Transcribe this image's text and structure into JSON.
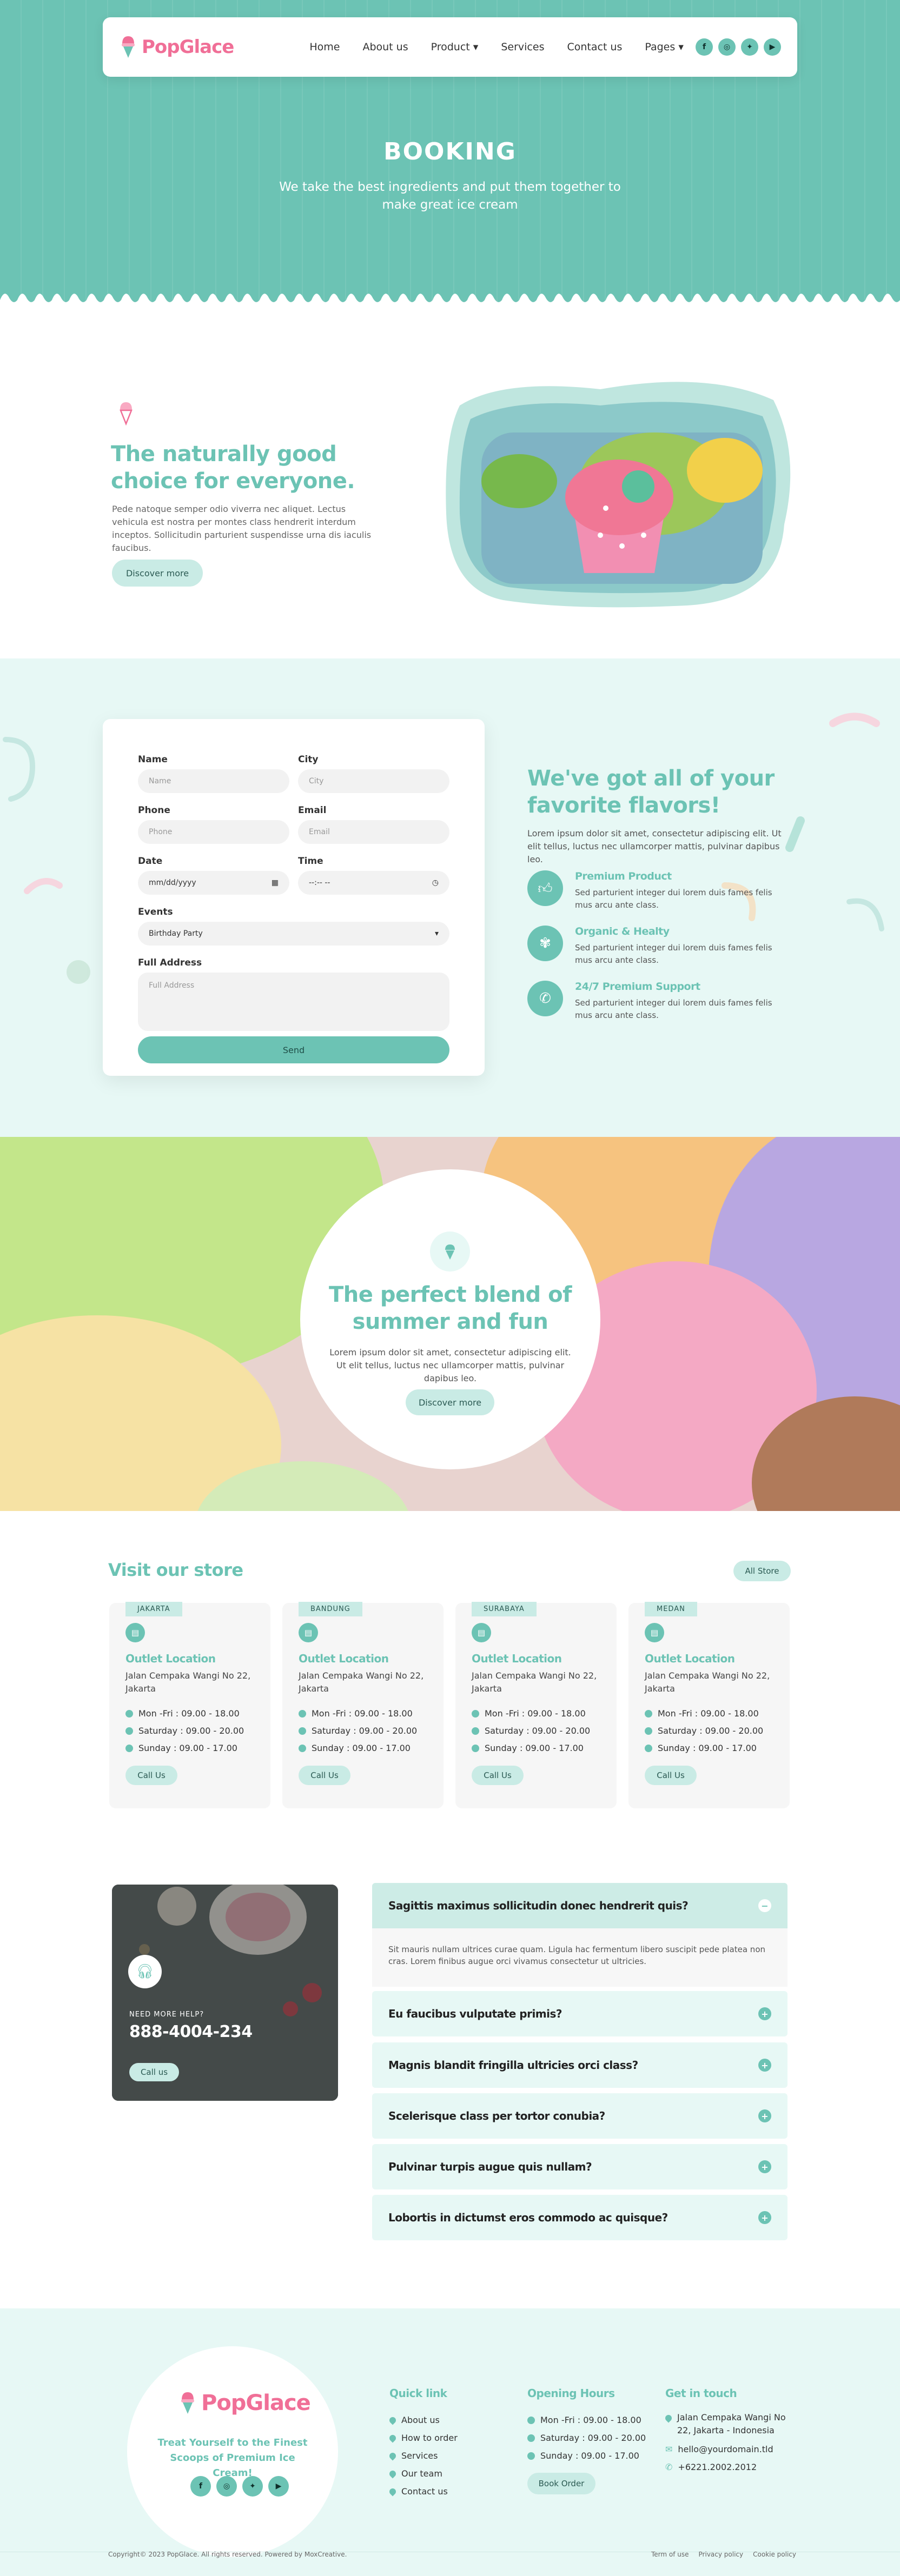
{
  "brand": {
    "name": "PopGlace",
    "accent": "#6cc3b4",
    "logo_color": "#f06f97"
  },
  "nav": {
    "items": [
      "Home",
      "About us",
      "Product",
      "Services",
      "Contact us",
      "Pages"
    ],
    "dropdown_items": [
      "Product",
      "Pages"
    ],
    "socials": [
      "facebook-icon",
      "instagram-icon",
      "twitter-icon",
      "youtube-icon"
    ]
  },
  "hero": {
    "title": "BOOKING",
    "subtitle": "We take the best ingredients and put them together to make great ice cream"
  },
  "intro": {
    "title": "The naturally good choice for everyone.",
    "text": "Pede natoque semper odio viverra nec aliquet. Lectus vehicula est nostra per montes class hendrerit interdum inceptos. Sollicitudin parturient suspendisse urna dis iaculis faucibus.",
    "button": "Discover more"
  },
  "form": {
    "name_label": "Name",
    "name_placeholder": "Name",
    "city_label": "City",
    "city_placeholder": "City",
    "phone_label": "Phone",
    "phone_placeholder": "Phone",
    "email_label": "Email",
    "email_placeholder": "Email",
    "date_label": "Date",
    "date_placeholder": "mm/dd/yyyy",
    "time_label": "Time",
    "time_placeholder": "--:-- --",
    "events_label": "Events",
    "events_value": "Birthday Party",
    "address_label": "Full Address",
    "address_placeholder": "Full Address",
    "send": "Send"
  },
  "flavors": {
    "title": "We've got all of your favorite flavors!",
    "text": "Lorem ipsum dolor sit amet, consectetur adipiscing elit. Ut elit tellus, luctus nec ullamcorper mattis, pulvinar dapibus leo.",
    "features": [
      {
        "title": "Premium Product",
        "text": "Sed parturient integer dui lorem duis fames felis mus arcu ante class.",
        "icon": "thumbs-up-icon"
      },
      {
        "title": "Organic & Healty",
        "text": "Sed parturient integer dui lorem duis fames felis mus arcu ante class.",
        "icon": "wheat-icon"
      },
      {
        "title": "24/7 Premium Support",
        "text": "Sed parturient integer dui lorem duis fames felis mus arcu ante class.",
        "icon": "phone-icon"
      }
    ]
  },
  "blend": {
    "title": "The perfect blend of summer and fun",
    "text": "Lorem ipsum dolor sit amet, consectetur adipiscing elit. Ut elit tellus, luctus nec ullamcorper mattis, pulvinar dapibus leo.",
    "button": "Discover more"
  },
  "stores": {
    "title": "Visit our store",
    "all_button": "All Store",
    "items": [
      {
        "tag": "JAKARTA",
        "name": "Outlet Location",
        "address": "Jalan Cempaka Wangi No 22, Jakarta",
        "hours": [
          "Mon -Fri : 09.00 - 18.00",
          "Saturday : 09.00 - 20.00",
          "Sunday : 09.00 - 17.00"
        ],
        "button": "Call Us"
      },
      {
        "tag": "BANDUNG",
        "name": "Outlet Location",
        "address": "Jalan Cempaka Wangi No 22, Jakarta",
        "hours": [
          "Mon -Fri : 09.00 - 18.00",
          "Saturday : 09.00 - 20.00",
          "Sunday : 09.00 - 17.00"
        ],
        "button": "Call Us"
      },
      {
        "tag": "SURABAYA",
        "name": "Outlet Location",
        "address": "Jalan Cempaka Wangi No 22, Jakarta",
        "hours": [
          "Mon -Fri : 09.00 - 18.00",
          "Saturday : 09.00 - 20.00",
          "Sunday : 09.00 - 17.00"
        ],
        "button": "Call Us"
      },
      {
        "tag": "MEDAN",
        "name": "Outlet Location",
        "address": "Jalan Cempaka Wangi No 22, Jakarta",
        "hours": [
          "Mon -Fri : 09.00 - 18.00",
          "Saturday : 09.00 - 20.00",
          "Sunday : 09.00 - 17.00"
        ],
        "button": "Call Us"
      }
    ]
  },
  "help": {
    "label": "NEED MORE HELP?",
    "phone": "888-4004-234",
    "button": "Call us"
  },
  "faq": {
    "items": [
      {
        "q": "Sagittis maximus sollicitudin donec hendrerit quis?",
        "a": "Sit mauris nullam ultrices curae quam. Ligula hac fermentum libero suscipit pede platea non cras. Lorem finibus augue orci vivamus consectetur ut ultricies.",
        "open": true
      },
      {
        "q": "Eu faucibus vulputate primis?",
        "open": false
      },
      {
        "q": "Magnis blandit fringilla ultricies orci class?",
        "open": false
      },
      {
        "q": "Scelerisque class per tortor conubia?",
        "open": false
      },
      {
        "q": "Pulvinar turpis augue quis nullam?",
        "open": false
      },
      {
        "q": "Lobortis in dictumst eros commodo ac quisque?",
        "open": false
      }
    ]
  },
  "footer": {
    "tagline": "Treat Yourself to the Finest Scoops of Premium Ice Cream!",
    "quick_title": "Quick link",
    "quick_links": [
      "About us",
      "How to order",
      "Services",
      "Our team",
      "Contact us"
    ],
    "hours_title": "Opening Hours",
    "hours": [
      "Mon -Fri : 09.00 - 18.00",
      "Saturday : 09.00 - 20.00",
      "Sunday : 09.00 - 17.00"
    ],
    "hours_button": "Book Order",
    "touch_title": "Get in touch",
    "address": "Jalan Cempaka Wangi No 22, Jakarta - Indonesia",
    "email": "hello@yourdomain.tld",
    "phone": "+6221.2002.2012",
    "copyright": "Copyright© 2023 PopGlace. All rights reserved. Powered by MoxCreative.",
    "legal": [
      "Term of use",
      "Privacy policy",
      "Cookie policy"
    ]
  }
}
